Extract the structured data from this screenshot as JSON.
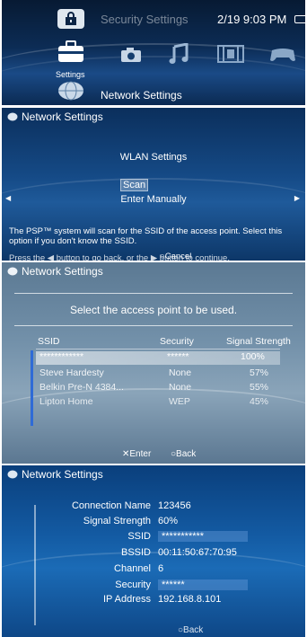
{
  "top_bar": {
    "section_title": "Security Settings",
    "clock": "2/19 9:03 PM"
  },
  "xmb": {
    "selected_category": "Settings",
    "categories": [
      {
        "icon": "settings-toolbox-icon"
      },
      {
        "icon": "photo-camera-icon"
      },
      {
        "icon": "music-note-icon"
      },
      {
        "icon": "video-film-icon"
      },
      {
        "icon": "game-controller-icon"
      }
    ],
    "current_item": "Network Settings"
  },
  "wlan_screen": {
    "header": "Network Settings",
    "title": "WLAN Settings",
    "options": [
      "Scan",
      "Enter Manually"
    ],
    "selected_option": "Scan",
    "description": "The PSP™ system will scan for the SSID of the access point. Select this option if you don't know the SSID.",
    "hint_prefix": "Press the",
    "hint_mid": "button to go back, or the",
    "hint_suffix": "button to continue.",
    "cancel_label": "Cancel"
  },
  "scan_screen": {
    "header": "Network Settings",
    "title": "Select the access point to be used.",
    "columns": [
      "SSID",
      "Security",
      "Signal Strength"
    ],
    "rows": [
      {
        "ssid": "************",
        "security": "******",
        "signal": "100%"
      },
      {
        "ssid": "Steve Hardesty",
        "security": "None",
        "signal": "57%"
      },
      {
        "ssid": "Belkin Pre-N 4384...",
        "security": "None",
        "signal": "55%"
      },
      {
        "ssid": "Lipton Home",
        "security": "WEP",
        "signal": "45%"
      }
    ],
    "selected_row": 0,
    "enter_label": "Enter",
    "back_label": "Back"
  },
  "details_screen": {
    "header": "Network Settings",
    "fields": [
      {
        "label": "Connection Name",
        "value": "123456"
      },
      {
        "label": "Signal Strength",
        "value": "60%"
      },
      {
        "label": "SSID",
        "value": "***********"
      },
      {
        "label": "BSSID",
        "value": "00:11:50:67:70:95"
      },
      {
        "label": "Channel",
        "value": "6"
      },
      {
        "label": "Security",
        "value": "******"
      },
      {
        "label": "IP Address",
        "value": "192.168.8.101"
      }
    ],
    "back_label": "Back"
  }
}
